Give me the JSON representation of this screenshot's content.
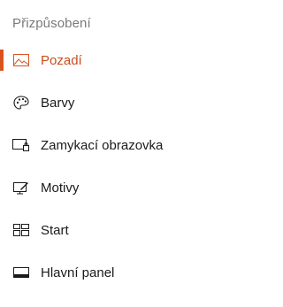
{
  "section": {
    "title": "Přizpůsobení"
  },
  "nav": {
    "active_index": 0,
    "accent_color": "#d9531e",
    "items": [
      {
        "label": "Pozadí",
        "icon": "picture-icon"
      },
      {
        "label": "Barvy",
        "icon": "palette-icon"
      },
      {
        "label": "Zamykací obrazovka",
        "icon": "lock-screen-icon"
      },
      {
        "label": "Motivy",
        "icon": "themes-icon"
      },
      {
        "label": "Start",
        "icon": "start-icon"
      },
      {
        "label": "Hlavní panel",
        "icon": "taskbar-icon"
      }
    ]
  }
}
